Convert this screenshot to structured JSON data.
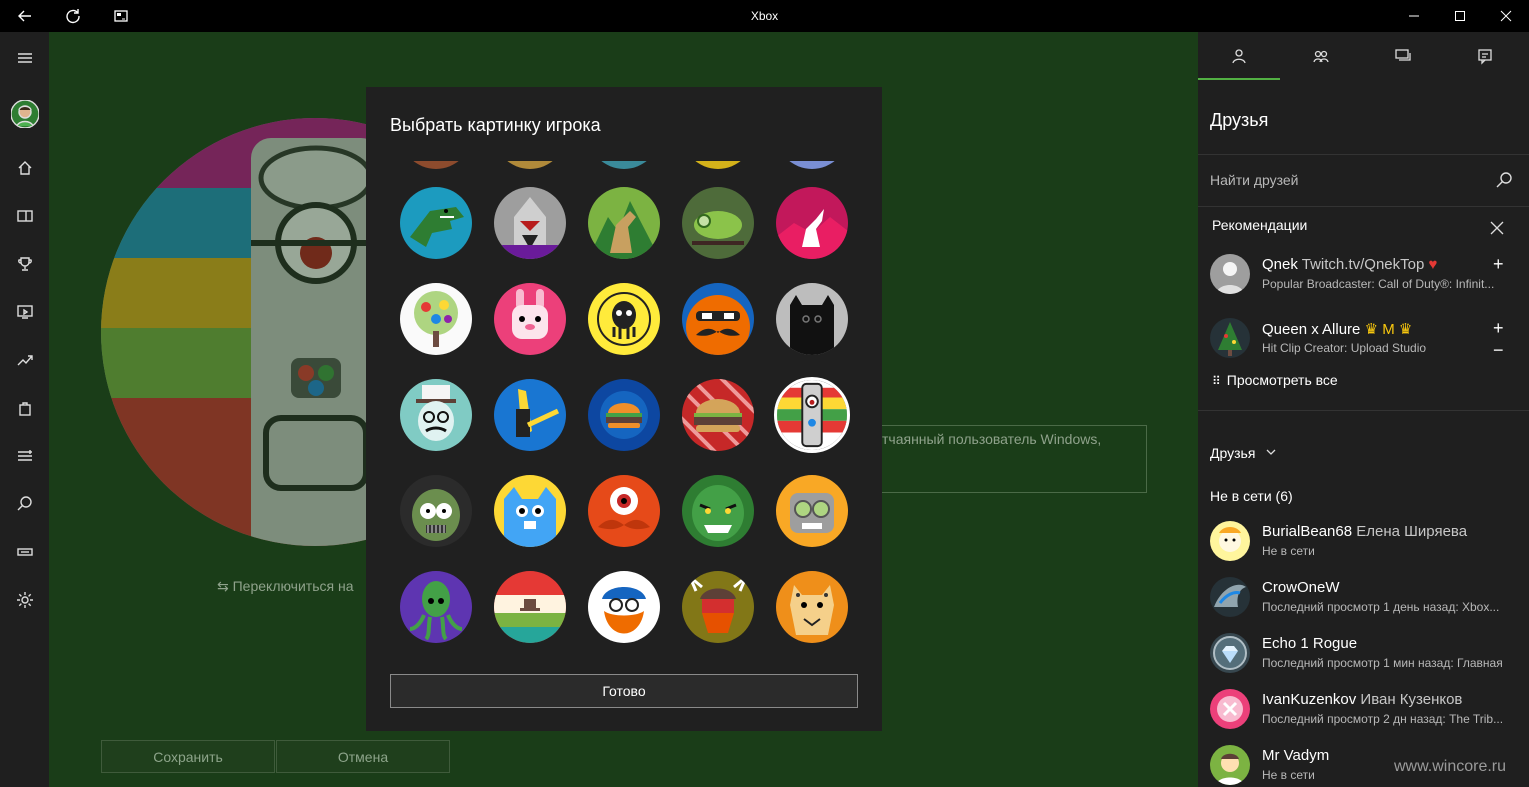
{
  "window": {
    "title": "Xbox"
  },
  "main": {
    "desc_partial": "н, отчаянный пользователь Windows,",
    "switch_label": "⇆  Переключиться на",
    "save_label": "Сохранить",
    "cancel_label": "Отмена"
  },
  "dialog": {
    "title": "Выбрать картинку игрока",
    "done_label": "Готово",
    "gamerpics": [
      "t-rex",
      "shark-suit",
      "howling-wolf",
      "chameleon",
      "unicorn",
      "colorful-tree",
      "pink-bunny",
      "yellow-octopus",
      "mustache-face",
      "black-monster",
      "skull-top-hat",
      "banana-guitar",
      "burger-blue",
      "burger-red",
      "totem-selected",
      "zombie",
      "blue-cat",
      "cyclops",
      "green-goblin",
      "robot-skull",
      "squid",
      "landscape-hat",
      "orange-beard",
      "viking",
      "cheetah"
    ],
    "selected": "totem-selected"
  },
  "right_panel": {
    "title": "Друзья",
    "search_placeholder": "Найти друзей",
    "recommendations_title": "Рекомендации",
    "recommendations": [
      {
        "gamertag": "Qnek",
        "extra": "Twitch.tv/QnekTop",
        "badge": "♥",
        "sub": "Popular Broadcaster: Call of Duty®: Infinit..."
      },
      {
        "gamertag": "Queen x Allure",
        "extra": "♛ M ♛",
        "badge": "",
        "sub": "Hit Clip Creator: Upload Studio"
      }
    ],
    "view_all": "Просмотреть все",
    "friends_header": "Друзья",
    "offline_header": "Не в сети (6)",
    "friends": [
      {
        "gamertag": "BurialBean68",
        "real_name": "Елена Ширяева",
        "status": "Не в сети"
      },
      {
        "gamertag": "CrowOneW",
        "real_name": "",
        "status": "Последний просмотр 1 день назад: Xbox..."
      },
      {
        "gamertag": "Echo 1 Rogue",
        "real_name": "",
        "status": "Последний просмотр 1 мин назад: Главная"
      },
      {
        "gamertag": "IvanKuzenkov",
        "real_name": "Иван Кузенков",
        "status": "Последний просмотр 2 дн назад: The Trib..."
      },
      {
        "gamertag": "Mr Vadym",
        "real_name": "",
        "status": "Не в сети"
      }
    ]
  },
  "watermark": "www.wincore.ru",
  "colors": {
    "accent": "#52b043",
    "main_bg": "#1a3d18",
    "dialog_bg": "#202020",
    "panel_bg": "#1f1f1f"
  }
}
